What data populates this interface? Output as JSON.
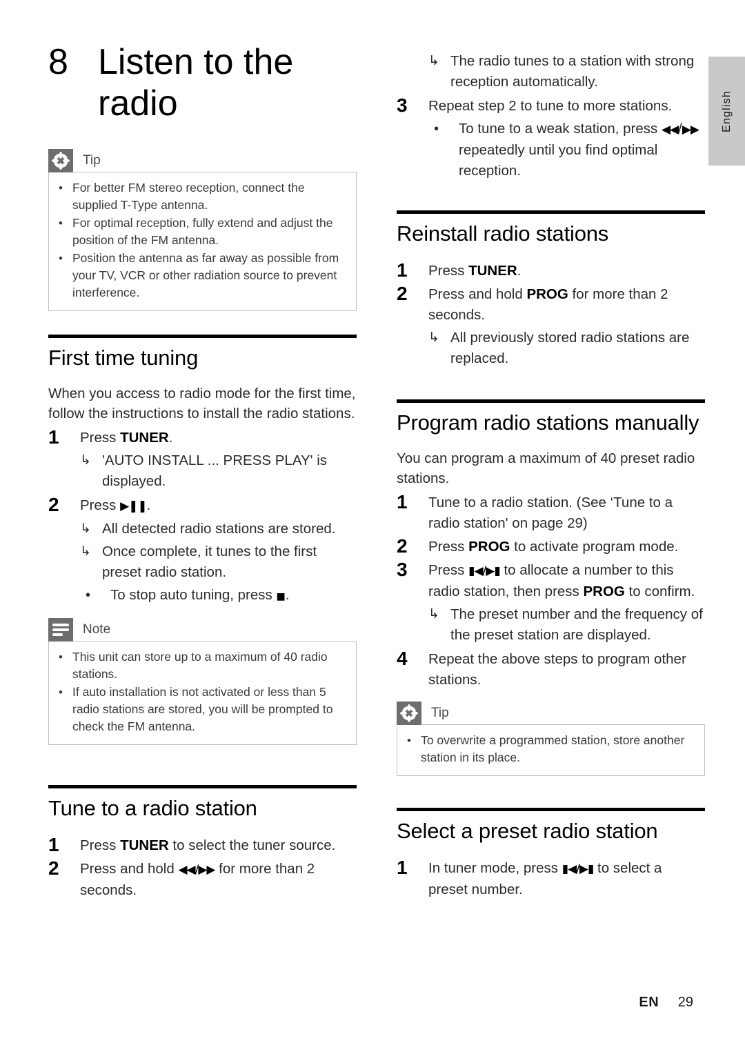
{
  "language_tab": {
    "label": "English"
  },
  "chapter": {
    "number": "8",
    "title": "Listen to the radio"
  },
  "footer": {
    "locale": "EN",
    "page": "29"
  },
  "left_column": {
    "tip_box": {
      "icon": "tip-asterisk-icon",
      "label": "Tip",
      "items": [
        "For better FM stereo reception, connect the supplied T-Type antenna.",
        "For optimal reception, fully extend and adjust the position of the FM antenna.",
        "Position the antenna as far away as possible from your TV, VCR or other radiation source to prevent interference."
      ]
    },
    "section_first_time_tuning": {
      "heading": "First time tuning",
      "intro": "When you access to radio mode for the first time, follow the instructions to install the radio stations.",
      "steps": [
        {
          "number": "1",
          "text_parts": [
            {
              "type": "text",
              "value": "Press "
            },
            {
              "type": "bold",
              "value": "TUNER"
            },
            {
              "type": "text",
              "value": "."
            }
          ],
          "results": [
            "'AUTO INSTALL ... PRESS PLAY' is displayed."
          ],
          "bullets": []
        },
        {
          "number": "2",
          "text_parts": [
            {
              "type": "text",
              "value": "Press "
            },
            {
              "type": "glyph",
              "value": "play-pause-icon",
              "char": "▶▐▐"
            },
            {
              "type": "text",
              "value": "."
            }
          ],
          "results": [
            "All detected radio stations are stored.",
            "Once complete, it tunes to the first preset radio station."
          ],
          "bullets": [
            {
              "parts": [
                {
                  "type": "text",
                  "value": "To stop auto tuning, press "
                },
                {
                  "type": "glyph",
                  "value": "stop-icon",
                  "char": "■"
                },
                {
                  "type": "text",
                  "value": "."
                }
              ]
            }
          ]
        }
      ]
    },
    "note_box": {
      "icon": "note-lines-icon",
      "label": "Note",
      "items": [
        "This unit can store up to a maximum of 40 radio stations.",
        "If auto installation is not activated or less than 5 radio stations are stored, you will be prompted to check the FM antenna."
      ]
    },
    "section_tune_to_station": {
      "heading": "Tune to a radio station",
      "steps": [
        {
          "number": "1",
          "text_parts": [
            {
              "type": "text",
              "value": "Press "
            },
            {
              "type": "bold",
              "value": "TUNER"
            },
            {
              "type": "text",
              "value": " to select the tuner source."
            }
          ],
          "results": [],
          "bullets": []
        },
        {
          "number": "2",
          "text_parts": [
            {
              "type": "text",
              "value": "Press and hold "
            },
            {
              "type": "glyph",
              "value": "rewind-forward-icon",
              "char": "◀◀/▶▶"
            },
            {
              "type": "text",
              "value": " for more than 2 seconds."
            }
          ],
          "results": [],
          "bullets": []
        }
      ]
    }
  },
  "right_column": {
    "continued_step2_results": [
      "The radio tunes to a station with strong reception automatically."
    ],
    "step3": {
      "number": "3",
      "text_parts": [
        {
          "type": "text",
          "value": "Repeat step 2 to tune to more stations."
        }
      ],
      "bullets": [
        {
          "parts": [
            {
              "type": "text",
              "value": "To tune to a weak station, press "
            },
            {
              "type": "glyph",
              "value": "rewind-icon",
              "char": "◀◀"
            },
            {
              "type": "text",
              "value": "/"
            },
            {
              "type": "glyph",
              "value": "forward-icon",
              "char": "▶▶"
            },
            {
              "type": "text",
              "value": " repeatedly until you find optimal reception."
            }
          ]
        }
      ]
    },
    "section_reinstall": {
      "heading": "Reinstall radio stations",
      "steps": [
        {
          "number": "1",
          "text_parts": [
            {
              "type": "text",
              "value": "Press "
            },
            {
              "type": "bold",
              "value": "TUNER"
            },
            {
              "type": "text",
              "value": "."
            }
          ],
          "results": [],
          "bullets": []
        },
        {
          "number": "2",
          "text_parts": [
            {
              "type": "text",
              "value": "Press and hold "
            },
            {
              "type": "bold",
              "value": "PROG"
            },
            {
              "type": "text",
              "value": " for more than 2 seconds."
            }
          ],
          "results": [
            "All previously stored radio stations are replaced."
          ],
          "bullets": []
        }
      ]
    },
    "section_program_manually": {
      "heading": "Program radio stations manually",
      "intro": "You can program a maximum of 40 preset radio stations.",
      "steps": [
        {
          "number": "1",
          "text_parts": [
            {
              "type": "text",
              "value": "Tune to a radio station. (See ‘Tune to a radio station' on page 29)"
            }
          ],
          "results": [],
          "bullets": []
        },
        {
          "number": "2",
          "text_parts": [
            {
              "type": "text",
              "value": "Press "
            },
            {
              "type": "bold",
              "value": "PROG"
            },
            {
              "type": "text",
              "value": " to activate program mode."
            }
          ],
          "results": [],
          "bullets": []
        },
        {
          "number": "3",
          "text_parts": [
            {
              "type": "text",
              "value": "Press "
            },
            {
              "type": "glyph",
              "value": "prev-next-icon",
              "char": "⏮/⏭"
            },
            {
              "type": "text",
              "value": " to allocate a number to this radio station, then press "
            },
            {
              "type": "bold",
              "value": "PROG"
            },
            {
              "type": "text",
              "value": " to confirm."
            }
          ],
          "results": [
            "The preset number and the frequency of the preset station are displayed."
          ],
          "bullets": []
        },
        {
          "number": "4",
          "text_parts": [
            {
              "type": "text",
              "value": "Repeat the above steps to program other stations."
            }
          ],
          "results": [],
          "bullets": []
        }
      ]
    },
    "tip_box": {
      "icon": "tip-asterisk-icon",
      "label": "Tip",
      "items": [
        "To overwrite a programmed station, store another station in its place."
      ]
    },
    "section_select_preset": {
      "heading": "Select a preset radio station",
      "steps": [
        {
          "number": "1",
          "text_parts": [
            {
              "type": "text",
              "value": "In tuner mode, press "
            },
            {
              "type": "glyph",
              "value": "prev-next-icon",
              "char": "⏮/⏭"
            },
            {
              "type": "text",
              "value": " to select a preset number."
            }
          ],
          "results": [],
          "bullets": []
        }
      ]
    }
  }
}
